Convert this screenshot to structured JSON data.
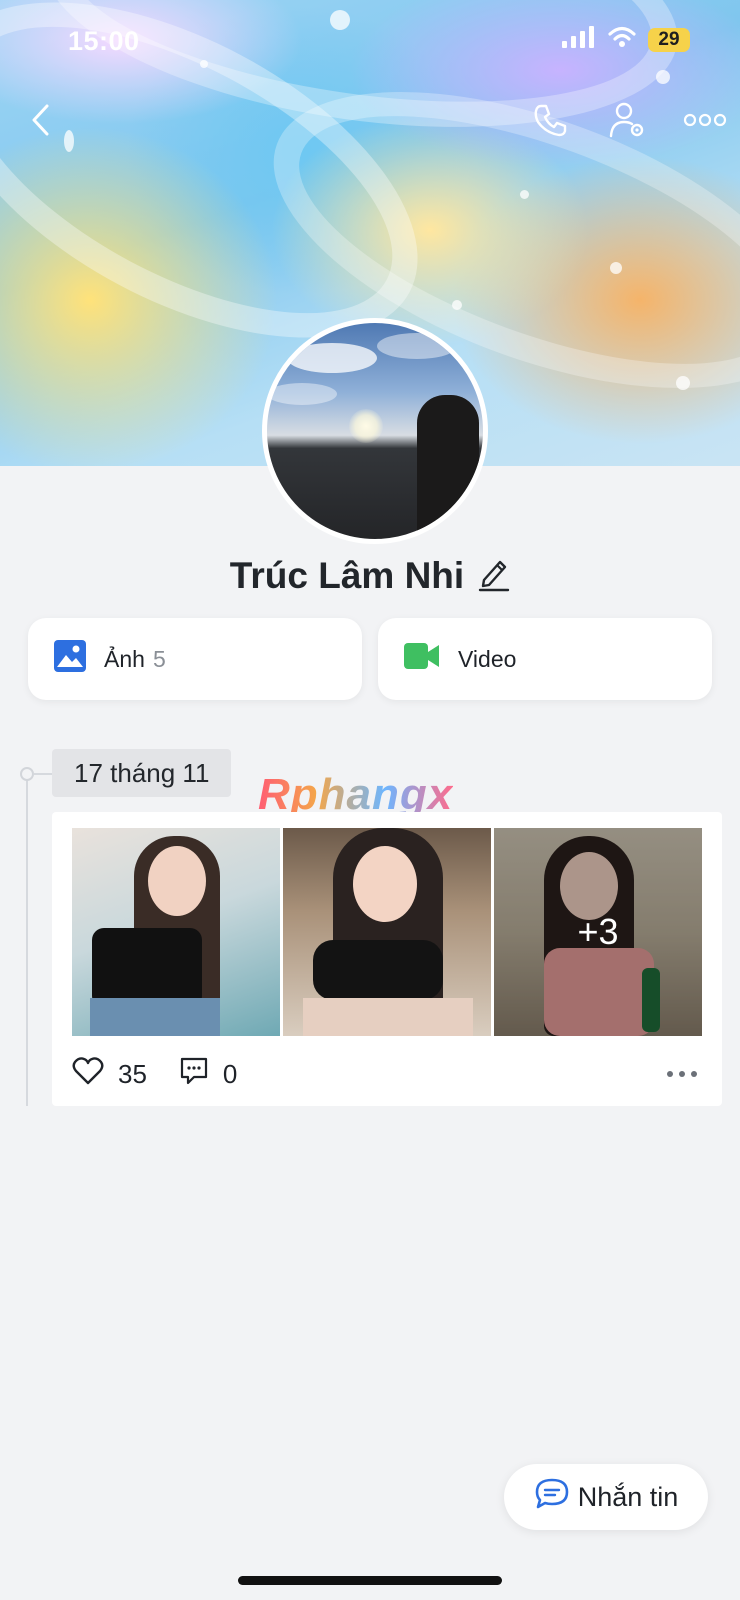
{
  "status_bar": {
    "time": "15:00",
    "battery": "29",
    "icons": [
      "signal-icon",
      "wifi-icon",
      "battery-icon"
    ]
  },
  "topbar": {
    "icons": [
      "back-icon",
      "phone-icon",
      "user-settings-icon",
      "more-icon"
    ]
  },
  "profile": {
    "name": "Trúc Lâm Nhi",
    "edit_icon": "pencil-icon"
  },
  "media": {
    "photos_label": "Ảnh",
    "photos_count": "5",
    "video_label": "Video"
  },
  "timeline": {
    "date": "17 tháng 11",
    "watermark": "Rphangx"
  },
  "post": {
    "extra_photos": "+3",
    "likes": "35",
    "comments": "0"
  },
  "message_button": {
    "label": "Nhắn tin"
  },
  "colors": {
    "accent_blue": "#2d6fe0",
    "video_green": "#3fbf61",
    "battery_yellow": "#f6d24a",
    "background": "#f2f3f5"
  }
}
